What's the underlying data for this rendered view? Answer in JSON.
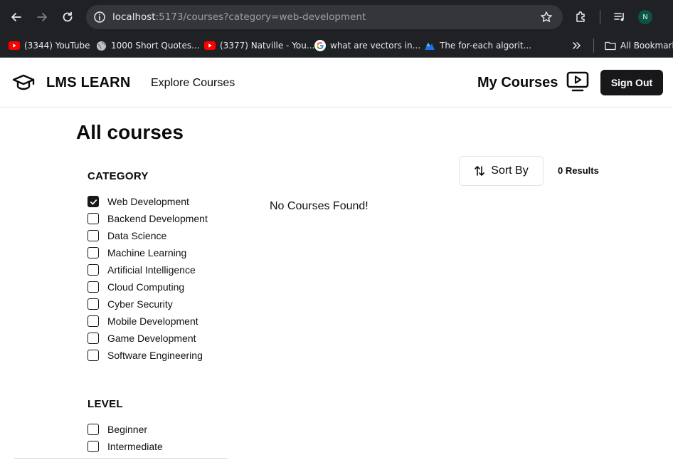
{
  "browser": {
    "url_host": "localhost",
    "url_rest": ":5173/courses?category=web-development",
    "profile_initial": "N",
    "bookmarks": [
      {
        "label": "(3344) YouTube",
        "icon": "youtube-icon"
      },
      {
        "label": "1000 Short Quotes...",
        "icon": "globe-icon"
      },
      {
        "label": "(3377) Natville - You...",
        "icon": "youtube-icon"
      },
      {
        "label": "what are vectors in...",
        "icon": "google-icon"
      },
      {
        "label": "The for-each algorit...",
        "icon": "site-icon"
      }
    ],
    "all_bookmarks_label": "All Bookmarks"
  },
  "header": {
    "brand": "LMS LEARN",
    "explore": "Explore Courses",
    "my_courses": "My Courses",
    "sign_out": "Sign Out"
  },
  "main": {
    "title": "All courses",
    "sort_label": "Sort By",
    "results": "0 Results",
    "empty": "No Courses Found!"
  },
  "filters": {
    "category_title": "CATEGORY",
    "categories": [
      {
        "label": "Web Development",
        "checked": true
      },
      {
        "label": "Backend Development",
        "checked": false
      },
      {
        "label": "Data Science",
        "checked": false
      },
      {
        "label": "Machine Learning",
        "checked": false
      },
      {
        "label": "Artificial Intelligence",
        "checked": false
      },
      {
        "label": "Cloud Computing",
        "checked": false
      },
      {
        "label": "Cyber Security",
        "checked": false
      },
      {
        "label": "Mobile Development",
        "checked": false
      },
      {
        "label": "Game Development",
        "checked": false
      },
      {
        "label": "Software Engineering",
        "checked": false
      }
    ],
    "level_title": "LEVEL",
    "levels": [
      {
        "label": "Beginner",
        "checked": false
      },
      {
        "label": "Intermediate",
        "checked": false
      }
    ]
  },
  "colors": {
    "chrome_bg": "#202124",
    "primary": "#18181b",
    "youtube_red": "#ff0000"
  }
}
